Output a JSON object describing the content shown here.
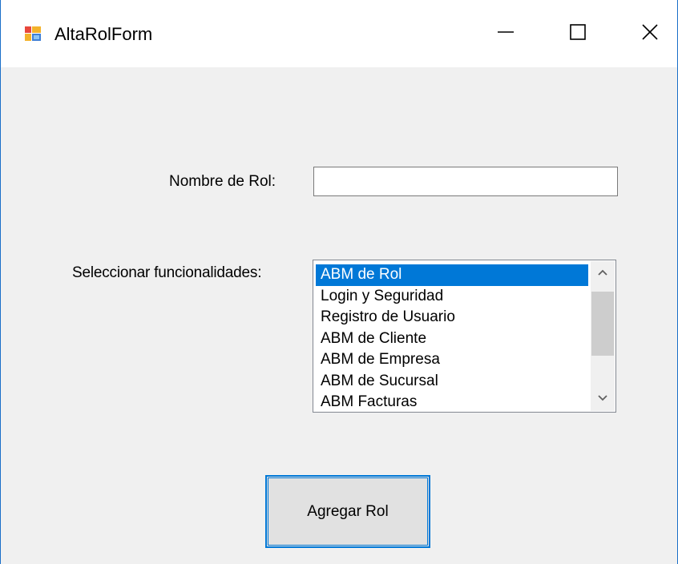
{
  "window": {
    "title": "AltaRolForm",
    "icon": "form-app-icon",
    "controls": {
      "minimize_icon": "minimize-icon",
      "maximize_icon": "maximize-icon",
      "close_icon": "close-icon"
    }
  },
  "form": {
    "nombre_label": "Nombre de Rol:",
    "nombre_value": "",
    "funcionalidades_label": "Seleccionar funcionalidades:",
    "funcionalidades": [
      {
        "label": "ABM de Rol",
        "selected": true
      },
      {
        "label": "Login y Seguridad",
        "selected": false
      },
      {
        "label": "Registro de Usuario",
        "selected": false
      },
      {
        "label": "ABM de Cliente",
        "selected": false
      },
      {
        "label": "ABM de Empresa",
        "selected": false
      },
      {
        "label": "ABM de Sucursal",
        "selected": false
      },
      {
        "label": "ABM Facturas",
        "selected": false
      }
    ],
    "submit_label": "Agregar Rol"
  },
  "colors": {
    "accent": "#0078d7",
    "window_bg": "#f0f0f0",
    "button_bg": "#e1e1e1"
  }
}
